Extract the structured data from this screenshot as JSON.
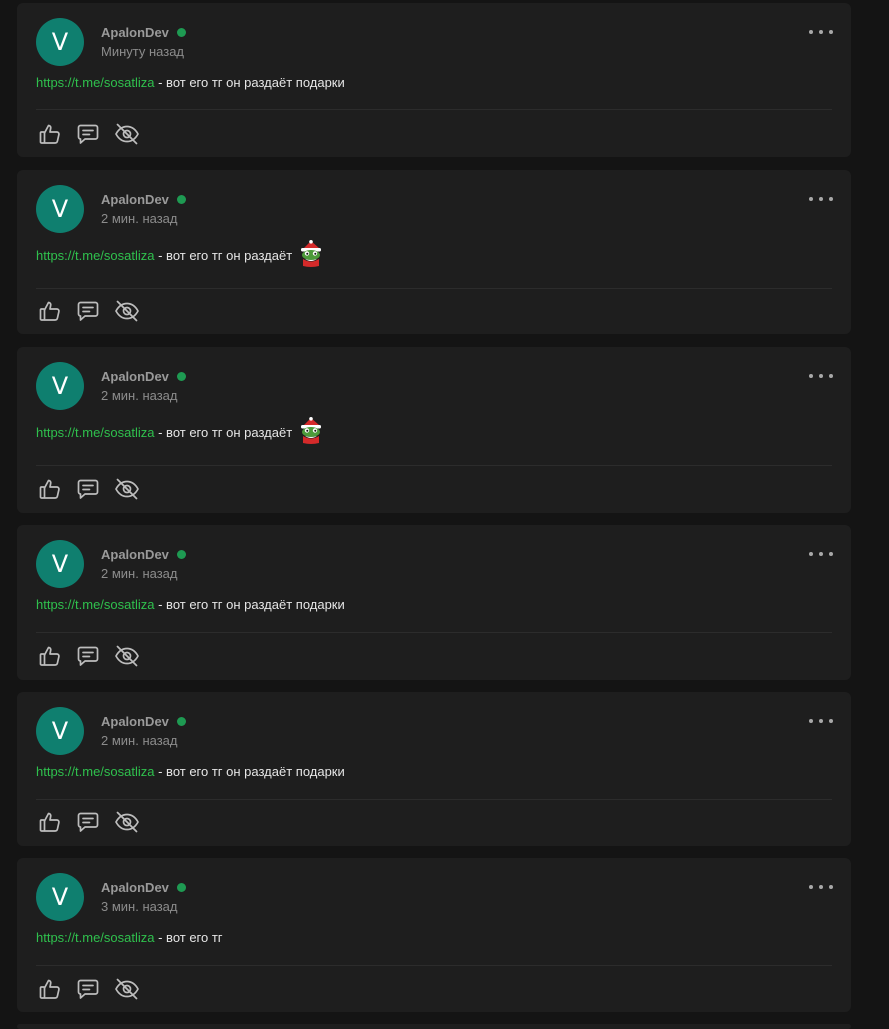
{
  "theme": {
    "background": "#141414",
    "card": "#1e1e1e",
    "avatar": "#0f7f6f",
    "link": "#2fc04d",
    "online": "#1e9a52"
  },
  "posts": [
    {
      "avatar_letter": "V",
      "author": "ApalonDev",
      "time": "Минуту назад",
      "link": "https://t.me/sosatliza",
      "text": " - вот его тг он раздаёт подарки",
      "has_sticker": false
    },
    {
      "avatar_letter": "V",
      "author": "ApalonDev",
      "time": "2 мин. назад",
      "link": "https://t.me/sosatliza",
      "text": " - вот его тг он раздаёт",
      "has_sticker": true
    },
    {
      "avatar_letter": "V",
      "author": "ApalonDev",
      "time": "2 мин. назад",
      "link": "https://t.me/sosatliza",
      "text": " - вот его тг он раздаёт",
      "has_sticker": true
    },
    {
      "avatar_letter": "V",
      "author": "ApalonDev",
      "time": "2 мин. назад",
      "link": "https://t.me/sosatliza",
      "text": " - вот его тг он раздаёт подарки",
      "has_sticker": false
    },
    {
      "avatar_letter": "V",
      "author": "ApalonDev",
      "time": "2 мин. назад",
      "link": "https://t.me/sosatliza",
      "text": " - вот его тг он раздаёт подарки",
      "has_sticker": false
    },
    {
      "avatar_letter": "V",
      "author": "ApalonDev",
      "time": "3 мин. назад",
      "link": "https://t.me/sosatliza",
      "text": " - вот его тг",
      "has_sticker": false
    }
  ],
  "icons": {
    "more": "more-dots-icon",
    "like": "thumbs-up-icon",
    "comment": "comment-icon",
    "hide": "eye-off-icon"
  }
}
